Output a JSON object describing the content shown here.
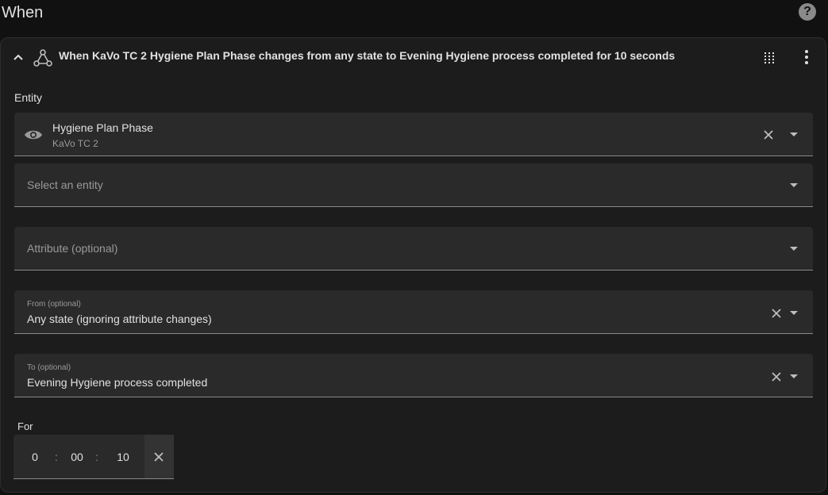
{
  "header": {
    "title": "When"
  },
  "trigger": {
    "summary": "When KaVo TC 2 Hygiene Plan Phase changes from any state to Evening Hygiene process completed for 10 seconds"
  },
  "entity_section": {
    "label": "Entity",
    "selected": {
      "name": "Hygiene Plan Phase",
      "device": "KaVo TC 2"
    },
    "add_placeholder": "Select an entity"
  },
  "attribute": {
    "placeholder": "Attribute (optional)"
  },
  "from": {
    "label": "From (optional)",
    "value": "Any state (ignoring attribute changes)"
  },
  "to": {
    "label": "To (optional)",
    "value": "Evening Hygiene process completed"
  },
  "for": {
    "label": "For",
    "hours": "0",
    "minutes": "00",
    "seconds": "10",
    "separator": ":"
  },
  "icons": {
    "help": "help-icon",
    "collapse": "chevron-up-icon",
    "trigger": "state-trigger-icon",
    "drag": "drag-handle-icon",
    "more": "more-vertical-icon",
    "eye": "eye-icon",
    "clear": "close-icon",
    "dropdown": "caret-down-icon"
  }
}
